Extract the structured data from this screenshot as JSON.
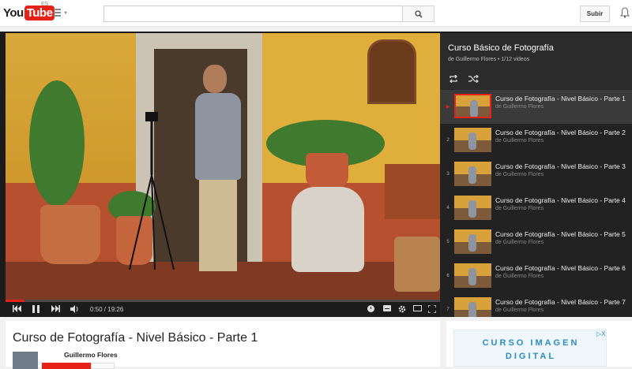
{
  "header": {
    "logo_you": "You",
    "logo_tube": "Tube",
    "region": "ES",
    "search_placeholder": "",
    "upload_label": "Subir"
  },
  "player": {
    "current_time": "0:50",
    "separator": " / ",
    "duration": "19:26",
    "progress_fraction": 0.043
  },
  "playlist": {
    "title": "Curso Básico de Fotografía",
    "subtitle": "de Guillermo Flores • 1/12 videos",
    "items": [
      {
        "index": "▶",
        "title": "Curso de Fotografía - Nivel Básico - Parte 1",
        "author": "de Guillermo Flores",
        "active": true
      },
      {
        "index": "2",
        "title": "Curso de Fotografía - Nivel Básico - Parte 2",
        "author": "de Guillermo Flores",
        "active": false
      },
      {
        "index": "3",
        "title": "Curso de Fotografía - Nivel Básico - Parte 3",
        "author": "de Guillermo Flores",
        "active": false
      },
      {
        "index": "4",
        "title": "Curso de Fotografía - Nivel Básico - Parte 4",
        "author": "de Guillermo Flores",
        "active": false
      },
      {
        "index": "5",
        "title": "Curso de Fotografía - Nivel Básico - Parte 5",
        "author": "de Guillermo Flores",
        "active": false
      },
      {
        "index": "6",
        "title": "Curso de Fotografía - Nivel Básico - Parte 6",
        "author": "de Guillermo Flores",
        "active": false
      },
      {
        "index": "7",
        "title": "Curso de Fotografía - Nivel Básico - Parte 7",
        "author": "de Guillermo Flores",
        "active": false
      }
    ]
  },
  "video_info": {
    "title": "Curso de Fotografía - Nivel Básico - Parte 1",
    "channel": "Guillermo Flores"
  },
  "ad": {
    "line1": "CURSO IMAGEN",
    "line2": "DIGITAL",
    "close": "▷X"
  },
  "colors": {
    "brand_red": "#e62117",
    "ad_blue": "#2e8bc9"
  }
}
